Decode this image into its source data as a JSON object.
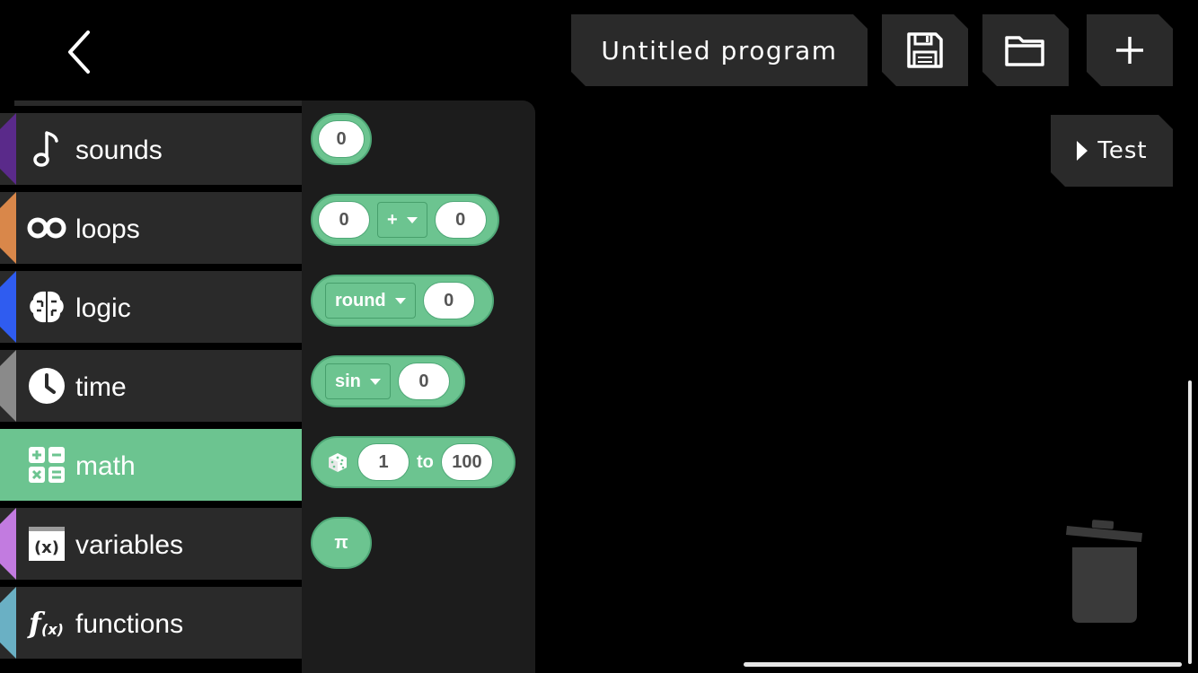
{
  "header": {
    "program_title": "Untitled program",
    "back_icon": "chevron-left-icon",
    "save_icon": "floppy-disk-icon",
    "open_icon": "folder-icon",
    "new_icon": "plus-icon"
  },
  "test_button": {
    "label": "Test",
    "icon": "play-icon"
  },
  "categories": [
    {
      "label": "sounds",
      "icon": "music-note-icon",
      "color": "#5a2a8a"
    },
    {
      "label": "loops",
      "icon": "infinity-icon",
      "color": "#d9874a"
    },
    {
      "label": "logic",
      "icon": "brain-icon",
      "color": "#2f5cf0"
    },
    {
      "label": "time",
      "icon": "clock-icon",
      "color": "#8a8a8a"
    },
    {
      "label": "math",
      "icon": "calculator-icon",
      "color": "#6cc490",
      "active": true
    },
    {
      "label": "variables",
      "icon": "variable-x-icon",
      "color": "#c27be0"
    },
    {
      "label": "functions",
      "icon": "function-fx-icon",
      "color": "#6ab0c4"
    }
  ],
  "flyout": {
    "number_block": {
      "value": "0"
    },
    "arithmetic_block": {
      "left": "0",
      "operator": "+",
      "right": "0"
    },
    "round_block": {
      "op": "round",
      "value": "0"
    },
    "trig_block": {
      "op": "sin",
      "value": "0"
    },
    "random_block": {
      "dice_icon": "dice-icon",
      "from": "1",
      "to_label": "to",
      "to": "100"
    },
    "constant_block": {
      "value": "π"
    }
  },
  "trash_icon": "trash-can-icon",
  "colors": {
    "math": "#6cc490",
    "panel": "#2a2a2a",
    "flyout": "#1c1c1c"
  }
}
